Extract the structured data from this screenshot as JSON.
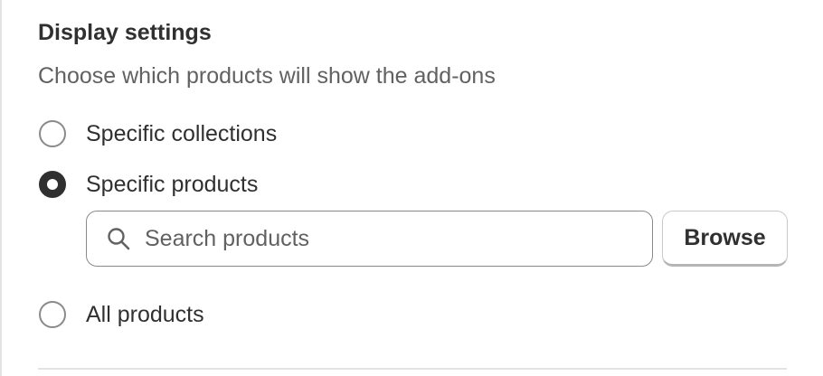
{
  "display_settings": {
    "title": "Display settings",
    "description": "Choose which products will show the add-ons",
    "options": [
      {
        "label": "Specific collections",
        "selected": false
      },
      {
        "label": "Specific products",
        "selected": true
      },
      {
        "label": "All products",
        "selected": false
      }
    ],
    "search": {
      "placeholder": "Search products",
      "value": "",
      "icon": "search-icon"
    },
    "browse_label": "Browse"
  }
}
